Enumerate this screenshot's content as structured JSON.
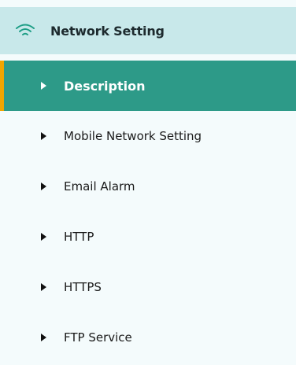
{
  "section": {
    "icon": "wifi-icon",
    "title": "Network Setting",
    "icon_color": "#1e9e86"
  },
  "menu": {
    "items": [
      {
        "label": "Description",
        "active": true,
        "icon": "caret-right-icon"
      },
      {
        "label": "Mobile Network Setting",
        "active": false,
        "icon": "caret-right-icon"
      },
      {
        "label": "Email Alarm",
        "active": false,
        "icon": "caret-right-icon"
      },
      {
        "label": "HTTP",
        "active": false,
        "icon": "caret-right-icon"
      },
      {
        "label": "HTTPS",
        "active": false,
        "icon": "caret-right-icon"
      },
      {
        "label": "FTP Service",
        "active": false,
        "icon": "caret-right-icon"
      }
    ]
  },
  "colors": {
    "active_bg": "#2d9a88",
    "active_accent": "#f0a500",
    "header_bg": "#c8e8ea",
    "page_bg": "#f4fbfc"
  }
}
